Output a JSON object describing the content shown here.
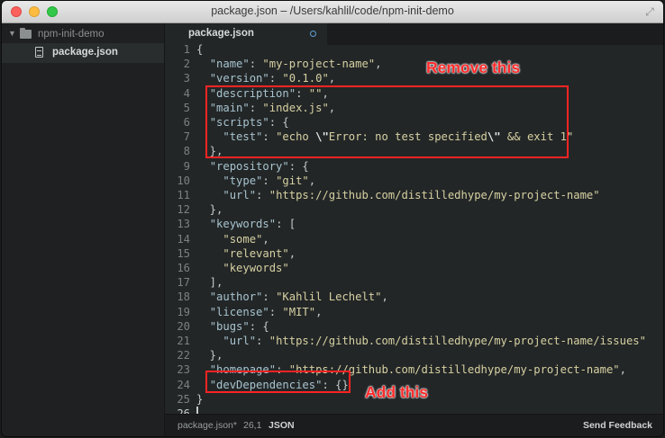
{
  "window": {
    "title": "package.json – /Users/kahlil/code/npm-init-demo"
  },
  "sidebar": {
    "folder": "npm-init-demo",
    "file": "package.json"
  },
  "tabs": [
    {
      "label": "package.json",
      "modified": true
    }
  ],
  "editor": {
    "lines": [
      [
        [
          "punc",
          "{"
        ]
      ],
      [
        [
          "punc",
          "  "
        ],
        [
          "key",
          "\"name\""
        ],
        [
          "punc",
          ": "
        ],
        [
          "str",
          "\"my-project-name\""
        ],
        [
          "punc",
          ","
        ]
      ],
      [
        [
          "punc",
          "  "
        ],
        [
          "key",
          "\"version\""
        ],
        [
          "punc",
          ": "
        ],
        [
          "str",
          "\"0.1.0\""
        ],
        [
          "punc",
          ","
        ]
      ],
      [
        [
          "punc",
          "  "
        ],
        [
          "key",
          "\"description\""
        ],
        [
          "punc",
          ": "
        ],
        [
          "str",
          "\"\""
        ],
        [
          "punc",
          ","
        ]
      ],
      [
        [
          "punc",
          "  "
        ],
        [
          "key",
          "\"main\""
        ],
        [
          "punc",
          ": "
        ],
        [
          "str",
          "\"index.js\""
        ],
        [
          "punc",
          ","
        ]
      ],
      [
        [
          "punc",
          "  "
        ],
        [
          "key",
          "\"scripts\""
        ],
        [
          "punc",
          ": {"
        ]
      ],
      [
        [
          "punc",
          "    "
        ],
        [
          "key",
          "\"test\""
        ],
        [
          "punc",
          ": "
        ],
        [
          "str",
          "\"echo "
        ],
        [
          "esc",
          "\\\""
        ],
        [
          "str",
          "Error: no test specified"
        ],
        [
          "esc",
          "\\\""
        ],
        [
          "str",
          " && exit 1\""
        ]
      ],
      [
        [
          "punc",
          "  },"
        ]
      ],
      [
        [
          "punc",
          "  "
        ],
        [
          "key",
          "\"repository\""
        ],
        [
          "punc",
          ": {"
        ]
      ],
      [
        [
          "punc",
          "    "
        ],
        [
          "key",
          "\"type\""
        ],
        [
          "punc",
          ": "
        ],
        [
          "str",
          "\"git\""
        ],
        [
          "punc",
          ","
        ]
      ],
      [
        [
          "punc",
          "    "
        ],
        [
          "key",
          "\"url\""
        ],
        [
          "punc",
          ": "
        ],
        [
          "str",
          "\"https://github.com/distilledhype/my-project-name\""
        ]
      ],
      [
        [
          "punc",
          "  },"
        ]
      ],
      [
        [
          "punc",
          "  "
        ],
        [
          "key",
          "\"keywords\""
        ],
        [
          "punc",
          ": ["
        ]
      ],
      [
        [
          "punc",
          "    "
        ],
        [
          "str",
          "\"some\""
        ],
        [
          "punc",
          ","
        ]
      ],
      [
        [
          "punc",
          "    "
        ],
        [
          "str",
          "\"relevant\""
        ],
        [
          "punc",
          ","
        ]
      ],
      [
        [
          "punc",
          "    "
        ],
        [
          "str",
          "\"keywords\""
        ]
      ],
      [
        [
          "punc",
          "  ],"
        ]
      ],
      [
        [
          "punc",
          "  "
        ],
        [
          "key",
          "\"author\""
        ],
        [
          "punc",
          ": "
        ],
        [
          "str",
          "\"Kahlil Lechelt\""
        ],
        [
          "punc",
          ","
        ]
      ],
      [
        [
          "punc",
          "  "
        ],
        [
          "key",
          "\"license\""
        ],
        [
          "punc",
          ": "
        ],
        [
          "str",
          "\"MIT\""
        ],
        [
          "punc",
          ","
        ]
      ],
      [
        [
          "punc",
          "  "
        ],
        [
          "key",
          "\"bugs\""
        ],
        [
          "punc",
          ": {"
        ]
      ],
      [
        [
          "punc",
          "    "
        ],
        [
          "key",
          "\"url\""
        ],
        [
          "punc",
          ": "
        ],
        [
          "str",
          "\"https://github.com/distilledhype/my-project-name/issues\""
        ]
      ],
      [
        [
          "punc",
          "  },"
        ]
      ],
      [
        [
          "punc",
          "  "
        ],
        [
          "key",
          "\"homepage\""
        ],
        [
          "punc",
          ": "
        ],
        [
          "str",
          "\"https://github.com/distilledhype/my-project-name\""
        ],
        [
          "punc",
          ","
        ]
      ],
      [
        [
          "punc",
          "  "
        ],
        [
          "key",
          "\"devDependencies\""
        ],
        [
          "punc",
          ": {}"
        ]
      ],
      [
        [
          "punc",
          "}"
        ]
      ],
      [
        [
          "punc",
          ""
        ]
      ]
    ],
    "line_numbers": [
      "1",
      "2",
      "3",
      "4",
      "5",
      "6",
      "7",
      "8",
      "9",
      "10",
      "11",
      "12",
      "13",
      "14",
      "15",
      "16",
      "17",
      "18",
      "19",
      "20",
      "21",
      "22",
      "23",
      "24",
      "25",
      "26"
    ],
    "active_line": 26
  },
  "annotations": {
    "remove": "Remove this",
    "add": "Add this"
  },
  "statusbar": {
    "file": "package.json*",
    "position": "26,1",
    "grammar": "JSON",
    "feedback": "Send Feedback"
  },
  "colors": {
    "annotation": "#ff2424",
    "key": "#a7c4cf",
    "string": "#d6d1a2"
  }
}
